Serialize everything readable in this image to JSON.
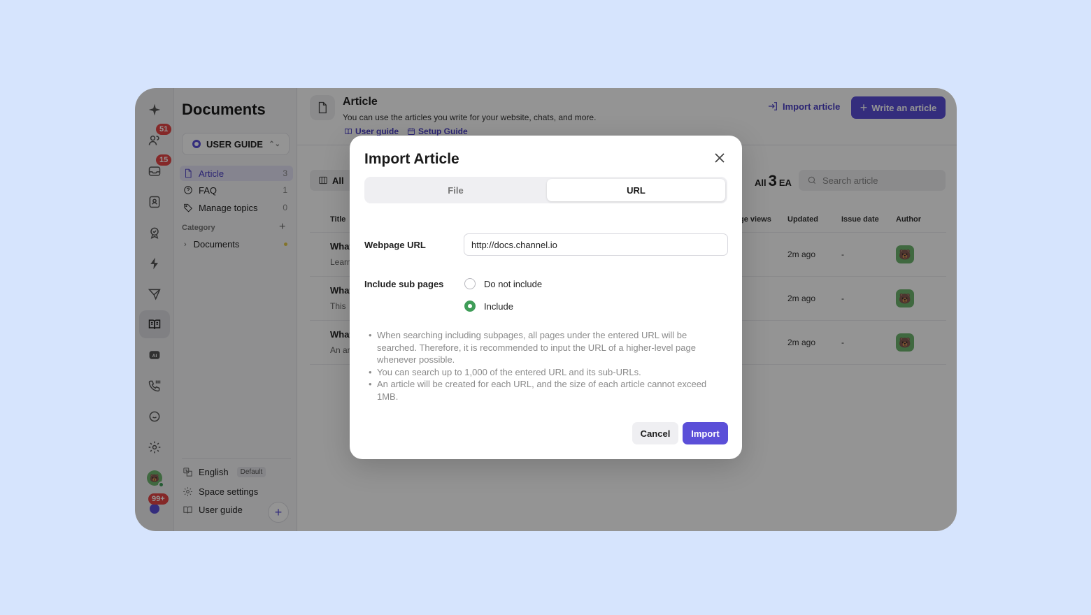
{
  "rail": {
    "badges": {
      "people": "51",
      "inbox": "15",
      "notifications": "99+"
    }
  },
  "sidebar": {
    "title": "Documents",
    "space": "USER GUIDE",
    "items": [
      {
        "label": "Article",
        "count": "3"
      },
      {
        "label": "FAQ",
        "count": "1"
      },
      {
        "label": "Manage topics",
        "count": "0"
      }
    ],
    "category_label": "Category",
    "categories": [
      {
        "label": "Documents"
      }
    ],
    "footer": {
      "language": "English",
      "language_tag": "Default",
      "settings": "Space settings",
      "guide": "User guide"
    }
  },
  "header": {
    "title": "Article",
    "description": "You can use the articles you write for your website,  chats, and more.",
    "link_user_guide": "User guide",
    "link_setup_guide": "Setup Guide",
    "import_label": "Import article",
    "write_label": "Write an article"
  },
  "toolbar": {
    "filter_all": "All",
    "count_prefix": "All",
    "count_value": "3",
    "count_suffix": "EA",
    "search_placeholder": "Search article"
  },
  "table": {
    "columns": {
      "title": "Title",
      "views": "ge views",
      "updated": "Updated",
      "issue": "Issue date",
      "author": "Author"
    },
    "rows": [
      {
        "title": "What",
        "sub": "Learn",
        "updated": "2m ago",
        "issue": "-"
      },
      {
        "title": "What",
        "sub": "This",
        "updated": "2m ago",
        "issue": "-"
      },
      {
        "title": "What",
        "sub": "An ar",
        "updated": "2m ago",
        "issue": "-"
      }
    ]
  },
  "modal": {
    "title": "Import Article",
    "tab_file": "File",
    "tab_url": "URL",
    "url_label": "Webpage URL",
    "url_value": "http://docs.channel.io",
    "sub_label": "Include sub pages",
    "option_exclude": "Do not include",
    "option_include": "Include",
    "selected_option": "Include",
    "notes": [
      "When searching including subpages, all pages under the entered URL will be searched. Therefore, it is recommended to input the URL of a higher-level page whenever possible.",
      "You can search up to 1,000 of the entered URL and its sub-URLs.",
      "An article will be created for each URL, and the size of each article cannot exceed 1MB."
    ],
    "cancel_label": "Cancel",
    "import_label": "Import"
  },
  "colors": {
    "background": "#d6e4fd",
    "accent": "#5b4fd8",
    "radio_selected": "#3f9d58",
    "badge": "#e54545"
  }
}
